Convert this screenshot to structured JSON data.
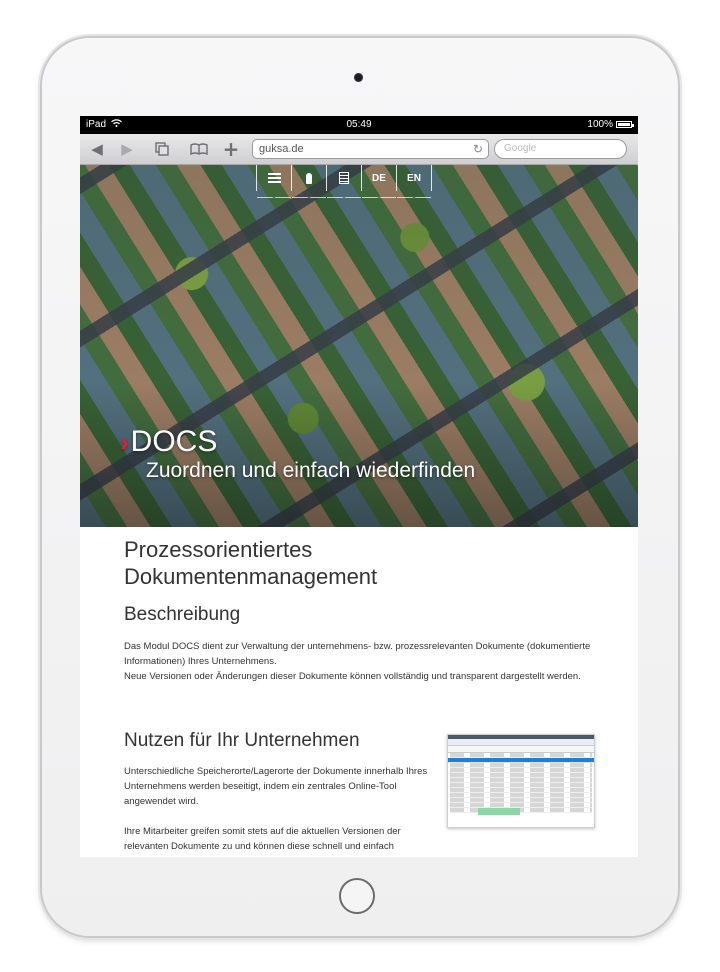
{
  "device": {
    "model": "iPad"
  },
  "status_bar": {
    "carrier": "iPad",
    "wifi_icon": "wifi-icon",
    "time": "05:49",
    "battery_percent": "100%",
    "battery_level": 1.0
  },
  "browser": {
    "back_icon": "back-arrow-icon",
    "forward_icon": "forward-arrow-icon",
    "tabs_icon": "tabs-icon",
    "bookmarks_icon": "bookmarks-book-icon",
    "add_icon": "plus-icon",
    "url": "guksa.de",
    "reload_icon": "reload-icon",
    "search_placeholder": "Google"
  },
  "site_nav": {
    "items": [
      {
        "type": "icon",
        "icon": "menu-icon"
      },
      {
        "type": "icon",
        "icon": "lock-keyhole-icon"
      },
      {
        "type": "icon",
        "icon": "document-icon"
      },
      {
        "type": "text",
        "label": "DE"
      },
      {
        "type": "text",
        "label": "EN"
      }
    ]
  },
  "hero": {
    "chevron": "›",
    "title": "DOCS",
    "subtitle": "Zuordnen und einfach wiederfinden",
    "accent_color": "#e3202a"
  },
  "content": {
    "heading": "Prozessorientiertes Dokumentenmanagement",
    "heading_line1": "Prozessorientiertes",
    "heading_line2": "Dokumentenmanagement",
    "section1": {
      "title": "Beschreibung",
      "paragraph_line1": "Das Modul DOCS dient zur Verwaltung der unternehmens- bzw. prozessrelevanten Dokumente (dokumentierte Informationen) Ihres Unternehmens.",
      "paragraph_line2": "Neue Versionen oder Änderungen dieser Dokumente können vollständig und transparent dargestellt werden."
    },
    "section2": {
      "title": "Nutzen für Ihr Unternehmen",
      "paragraph1": "Unterschiedliche Speicherorte/Lagerorte der Dokumente innerhalb Ihres Unternehmens werden beseitigt, indem ein zentrales Online-Tool angewendet wird.",
      "paragraph2": "Ihre Mitarbeiter greifen somit stets auf die aktuellen Versionen der relevanten Dokumente zu und können diese schnell und einfach",
      "screenshot_alt": "DOCS application screenshot"
    }
  }
}
